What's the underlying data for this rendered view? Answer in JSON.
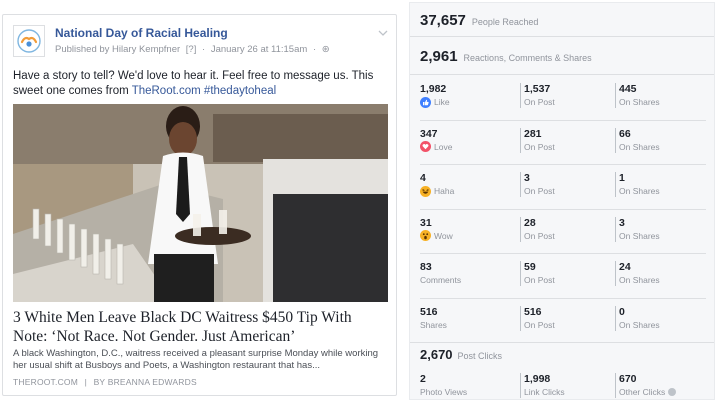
{
  "stray_mark": ":",
  "post": {
    "page_name": "National Day of Racial Healing",
    "published_by": "Published by Hilary Kempfner",
    "help_marker": "[?]",
    "date": "January 26 at 11:15am",
    "separator": "·",
    "globe_symbol": "⊛",
    "text_before_link": "Have a story to tell? We'd love to hear it. Feel free to message us. This sweet one comes from ",
    "link_text": "TheRoot.com",
    "hashtag": "#thedaytoheal",
    "link_title": "3 White Men Leave Black DC Waitress $450 Tip With Note: ‘Not Race. Not Gender. Just American’",
    "link_description": "A black Washington, D.C., waitress received a pleasant surprise Monday while working her usual shift at Busboys and Poets, a Washington restaurant that has...",
    "link_domain": "THEROOT.COM",
    "link_divider": "|",
    "link_author": "BY BREANNA EDWARDS"
  },
  "insights": {
    "reached": {
      "value": "37,657",
      "label": "People Reached"
    },
    "reactions": {
      "value": "2,961",
      "label": "Reactions, Comments & Shares"
    },
    "rows": [
      {
        "total": "1,982",
        "label": "Like",
        "icon": "like-icon",
        "color": "#4080ff",
        "on_post": "1,537",
        "on_shares": "445"
      },
      {
        "total": "347",
        "label": "Love",
        "icon": "love-icon",
        "color": "#f25268",
        "on_post": "281",
        "on_shares": "66"
      },
      {
        "total": "4",
        "label": "Haha",
        "icon": "haha-icon",
        "color": "#f7b125",
        "on_post": "3",
        "on_shares": "1"
      },
      {
        "total": "31",
        "label": "Wow",
        "icon": "wow-icon",
        "color": "#f7b125",
        "on_post": "28",
        "on_shares": "3"
      },
      {
        "total": "83",
        "label": "Comments",
        "icon": "",
        "color": "",
        "on_post": "59",
        "on_shares": "24"
      },
      {
        "total": "516",
        "label": "Shares",
        "icon": "",
        "color": "",
        "on_post": "516",
        "on_shares": "0"
      }
    ],
    "on_post_label": "On Post",
    "on_shares_label": "On Shares",
    "post_clicks": {
      "value": "2,670",
      "label": "Post Clicks"
    },
    "clicks": [
      {
        "value": "2",
        "label": "Photo Views"
      },
      {
        "value": "1,998",
        "label": "Link Clicks"
      },
      {
        "value": "670",
        "label": "Other Clicks"
      }
    ]
  }
}
